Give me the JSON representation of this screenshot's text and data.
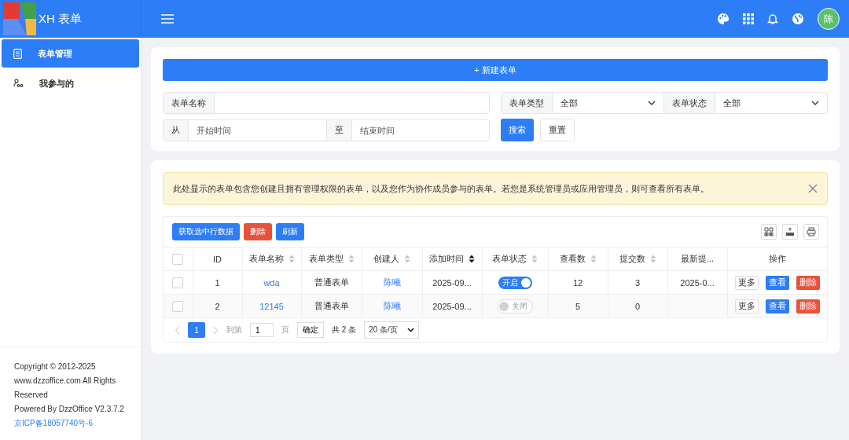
{
  "header": {
    "app_name": "XH 表单",
    "avatar_text": "陈"
  },
  "sidebar": {
    "items": [
      {
        "label": "表单管理",
        "selected": true,
        "kind": "document"
      },
      {
        "label": "我参与的",
        "selected": false,
        "kind": "people"
      }
    ],
    "footer": {
      "copyright": "Copyright © 2012-2025 www.dzzoffice.com All Rights Reserved",
      "powered": "Powered By DzzOffice V2.3.7.2",
      "icp": "京ICP备18057740号-6"
    }
  },
  "new_button": "+ 新建表单",
  "filters": {
    "name_label": "表单名称",
    "type_label": "表单类型",
    "type_value": "全部",
    "status_label": "表单状态",
    "status_value": "全部",
    "from_label": "从",
    "start_placeholder": "开始时间",
    "to_label": "至",
    "end_placeholder": "结束时间",
    "search": "搜索",
    "reset": "重置"
  },
  "alert": "此处显示的表单包含您创建且拥有管理权限的表单，以及您作为协作成员参与的表单。若您是系统管理员或应用管理员，则可查看所有表单。",
  "toolbar": [
    {
      "label": "获取选中行数据",
      "kind": "primary"
    },
    {
      "label": "删除",
      "kind": "danger"
    },
    {
      "label": "刷新",
      "kind": "primary"
    }
  ],
  "table": {
    "select_all_checked": false,
    "columns": [
      {
        "label": "ID",
        "sortable": false
      },
      {
        "label": "表单名称",
        "sortable": true,
        "sorted_desc": false
      },
      {
        "label": "表单类型",
        "sortable": true,
        "sorted_desc": false
      },
      {
        "label": "创建人",
        "sortable": true,
        "sorted_desc": false
      },
      {
        "label": "添加时间",
        "sortable": true,
        "sorted_desc": true
      },
      {
        "label": "表单状态",
        "sortable": true,
        "sorted_desc": false
      },
      {
        "label": "查看数",
        "sortable": true,
        "sorted_desc": false
      },
      {
        "label": "提交数",
        "sortable": true,
        "sorted_desc": false
      },
      {
        "label": "最新提...",
        "sortable": false
      },
      {
        "label": "操作",
        "sortable": false
      }
    ],
    "rows": [
      {
        "checked": false,
        "id": "1",
        "name": "wda",
        "type": "普通表单",
        "creator": "陈曦",
        "added": "2025-09...",
        "status_on": true,
        "status_label": "开启",
        "views": "12",
        "submits": "3",
        "latest": "2025-0...",
        "actions": [
          "更多",
          "查看",
          "删除"
        ]
      },
      {
        "checked": false,
        "id": "2",
        "name": "12145",
        "type": "普通表单",
        "creator": "陈曦",
        "added": "2025-09...",
        "status_on": false,
        "status_label": "关闭",
        "views": "5",
        "submits": "0",
        "latest": "",
        "actions": [
          "更多",
          "查看",
          "删除"
        ]
      }
    ]
  },
  "pager": {
    "pages": [
      {
        "label": "1",
        "selected": true
      }
    ],
    "goto_label": "到第",
    "goto_value": "1",
    "page_unit": "页",
    "confirm": "确定",
    "total": "共 2 条",
    "page_size": "20 条/页"
  }
}
